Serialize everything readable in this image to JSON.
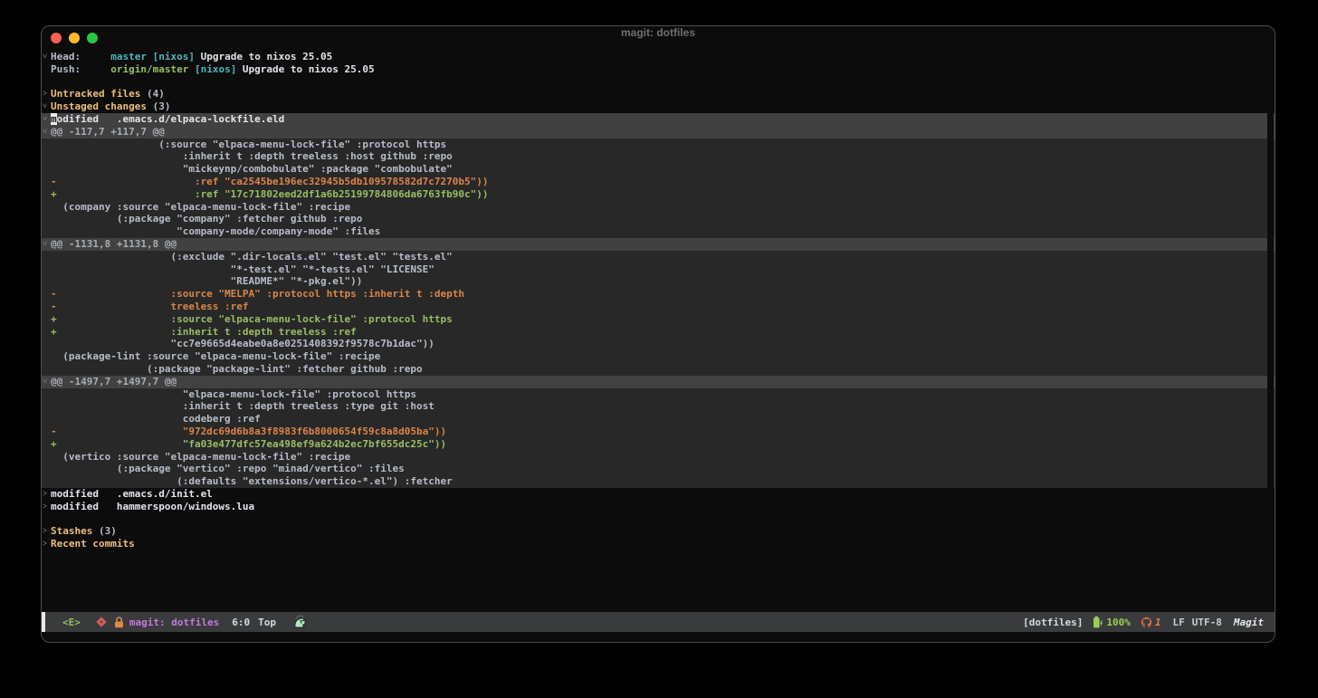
{
  "titlebar": {
    "title": "magit: dotfiles",
    "traffic_lights": [
      "close",
      "minimize",
      "zoom"
    ]
  },
  "palette": {
    "background": "#0c0c0c",
    "section_body_bg": "#282828",
    "section_header_bg": "#414141",
    "modeline_bg": "#3a3b3c",
    "heading_yellow": "#ecbe7b",
    "branch_cyan": "#4db5bd",
    "added_green": "#98be65",
    "removed_orange": "#da8548",
    "buffer_name_purple": "#c678dd",
    "foreground": "#b6bcc8",
    "traffic_red": "#ff5f57",
    "traffic_yellow": "#febc2e",
    "traffic_green": "#28c840"
  },
  "buffer": {
    "lines": [
      {
        "g": "v",
        "segs": [
          {
            "c": "label",
            "t": "Head:     "
          },
          {
            "c": "branch",
            "t": "master"
          },
          {
            "c": "ctx",
            "t": " "
          },
          {
            "c": "remote",
            "t": "[nixos]"
          },
          {
            "c": "msg",
            "t": " Upgrade to nixos 25.05"
          }
        ]
      },
      {
        "g": "",
        "segs": [
          {
            "c": "label",
            "t": "Push:     "
          },
          {
            "c": "branch2",
            "t": "origin/master"
          },
          {
            "c": "ctx",
            "t": " "
          },
          {
            "c": "remote",
            "t": "[nixos]"
          },
          {
            "c": "msg",
            "t": " Upgrade to nixos 25.05"
          }
        ]
      },
      {
        "g": "",
        "segs": []
      },
      {
        "g": ">",
        "name": "section-untracked-files",
        "segs": [
          {
            "c": "heading",
            "t": "Untracked files"
          },
          {
            "c": "count",
            "t": " (4)"
          }
        ]
      },
      {
        "g": "v",
        "name": "section-unstaged-changes",
        "segs": [
          {
            "c": "heading",
            "t": "Unstaged changes"
          },
          {
            "c": "count",
            "t": " (3)"
          }
        ]
      },
      {
        "g": "v",
        "bg": "filehead",
        "name": "file-section-header",
        "segs": [
          {
            "c": "cursor",
            "t": "m"
          },
          {
            "c": "file",
            "t": "odified   .emacs.d/elpaca-lockfile.eld"
          }
        ]
      },
      {
        "g": "v",
        "bg": "hunkhead",
        "name": "hunk-header",
        "segs": [
          {
            "c": "hunk",
            "t": "@@ -117,7 +117,7 @@"
          }
        ]
      },
      {
        "g": "",
        "bg": "body",
        "segs": [
          {
            "c": "ctx",
            "t": "                  (:source \"elpaca-menu-lock-file\" :protocol https"
          }
        ]
      },
      {
        "g": "",
        "bg": "body",
        "segs": [
          {
            "c": "ctx",
            "t": "                      :inherit t :depth treeless :host github :repo"
          }
        ]
      },
      {
        "g": "",
        "bg": "body",
        "segs": [
          {
            "c": "ctx",
            "t": "                      \"mickeynp/combobulate\" :package \"combobulate\""
          }
        ]
      },
      {
        "g": "",
        "bg": "body",
        "segs": [
          {
            "c": "del",
            "t": "-                       :ref \"ca2545be196ec32945b5db109578582d7c7270b5\"))"
          }
        ]
      },
      {
        "g": "",
        "bg": "body",
        "segs": [
          {
            "c": "add",
            "t": "+                       :ref \"17c71802eed2df1a6b25199784806da6763fb90c\"))"
          }
        ]
      },
      {
        "g": "",
        "bg": "body",
        "segs": [
          {
            "c": "ctx",
            "t": "  (company :source \"elpaca-menu-lock-file\" :recipe"
          }
        ]
      },
      {
        "g": "",
        "bg": "body",
        "segs": [
          {
            "c": "ctx",
            "t": "           (:package \"company\" :fetcher github :repo"
          }
        ]
      },
      {
        "g": "",
        "bg": "body",
        "segs": [
          {
            "c": "ctx",
            "t": "                     \"company-mode/company-mode\" :files"
          }
        ]
      },
      {
        "g": "v",
        "bg": "hunkhead",
        "name": "hunk-header",
        "segs": [
          {
            "c": "hunk",
            "t": "@@ -1131,8 +1131,8 @@"
          }
        ]
      },
      {
        "g": "",
        "bg": "body",
        "segs": [
          {
            "c": "ctx",
            "t": "                    (:exclude \".dir-locals.el\" \"test.el\" \"tests.el\""
          }
        ]
      },
      {
        "g": "",
        "bg": "body",
        "segs": [
          {
            "c": "ctx",
            "t": "                              \"*-test.el\" \"*-tests.el\" \"LICENSE\""
          }
        ]
      },
      {
        "g": "",
        "bg": "body",
        "segs": [
          {
            "c": "ctx",
            "t": "                              \"README*\" \"*-pkg.el\"))"
          }
        ]
      },
      {
        "g": "",
        "bg": "body",
        "segs": [
          {
            "c": "del",
            "t": "-                   :source \"MELPA\" :protocol https :inherit t :depth"
          }
        ]
      },
      {
        "g": "",
        "bg": "body",
        "segs": [
          {
            "c": "del",
            "t": "-                   treeless :ref"
          }
        ]
      },
      {
        "g": "",
        "bg": "body",
        "segs": [
          {
            "c": "add",
            "t": "+                   :source \"elpaca-menu-lock-file\" :protocol https"
          }
        ]
      },
      {
        "g": "",
        "bg": "body",
        "segs": [
          {
            "c": "add",
            "t": "+                   :inherit t :depth treeless :ref"
          }
        ]
      },
      {
        "g": "",
        "bg": "body",
        "segs": [
          {
            "c": "ctx",
            "t": "                    \"cc7e9665d4eabe0a8e0251408392f9578c7b1dac\"))"
          }
        ]
      },
      {
        "g": "",
        "bg": "body",
        "segs": [
          {
            "c": "ctx",
            "t": "  (package-lint :source \"elpaca-menu-lock-file\" :recipe"
          }
        ]
      },
      {
        "g": "",
        "bg": "body",
        "segs": [
          {
            "c": "ctx",
            "t": "                (:package \"package-lint\" :fetcher github :repo"
          }
        ]
      },
      {
        "g": "v",
        "bg": "hunkhead",
        "name": "hunk-header",
        "segs": [
          {
            "c": "hunk",
            "t": "@@ -1497,7 +1497,7 @@"
          }
        ]
      },
      {
        "g": "",
        "bg": "body",
        "segs": [
          {
            "c": "ctx",
            "t": "                      \"elpaca-menu-lock-file\" :protocol https"
          }
        ]
      },
      {
        "g": "",
        "bg": "body",
        "segs": [
          {
            "c": "ctx",
            "t": "                      :inherit t :depth treeless :type git :host"
          }
        ]
      },
      {
        "g": "",
        "bg": "body",
        "segs": [
          {
            "c": "ctx",
            "t": "                      codeberg :ref"
          }
        ]
      },
      {
        "g": "",
        "bg": "body",
        "segs": [
          {
            "c": "del",
            "t": "-                     \"972dc69d6b8a3f8983f6b8000654f59c8a8d05ba\"))"
          }
        ]
      },
      {
        "g": "",
        "bg": "body",
        "segs": [
          {
            "c": "add",
            "t": "+                     \"fa03e477dfc57ea498ef9a624b2ec7bf655dc25c\"))"
          }
        ]
      },
      {
        "g": "",
        "bg": "body",
        "segs": [
          {
            "c": "ctx",
            "t": "  (vertico :source \"elpaca-menu-lock-file\" :recipe"
          }
        ]
      },
      {
        "g": "",
        "bg": "body",
        "segs": [
          {
            "c": "ctx",
            "t": "           (:package \"vertico\" :repo \"minad/vertico\" :files"
          }
        ]
      },
      {
        "g": "",
        "bg": "body",
        "segs": [
          {
            "c": "ctx",
            "t": "                     (:defaults \"extensions/vertico-*.el\") :fetcher"
          }
        ]
      },
      {
        "g": ">",
        "name": "file-section-header",
        "segs": [
          {
            "c": "file",
            "t": "modified   .emacs.d/init.el"
          }
        ]
      },
      {
        "g": ">",
        "name": "file-section-header",
        "segs": [
          {
            "c": "file",
            "t": "modified   hammerspoon/windows.lua"
          }
        ]
      },
      {
        "g": "",
        "segs": []
      },
      {
        "g": ">",
        "name": "section-stashes",
        "segs": [
          {
            "c": "heading",
            "t": "Stashes"
          },
          {
            "c": "count",
            "t": " (3)"
          }
        ]
      },
      {
        "g": ">",
        "name": "section-recent-commits",
        "segs": [
          {
            "c": "heading",
            "t": "Recent commits"
          }
        ]
      }
    ]
  },
  "modeline": {
    "evil_state": "<E>",
    "buffer_name": "magit: dotfiles",
    "position": "6:0",
    "scroll": "Top",
    "project": "[dotfiles]",
    "battery": "100%",
    "github_count": "1",
    "eol": "LF",
    "encoding": "UTF-8",
    "major_mode": "Magit",
    "icons": [
      "alert-diamond-icon",
      "lock-icon",
      "pet-icon",
      "battery-icon",
      "github-icon"
    ]
  }
}
